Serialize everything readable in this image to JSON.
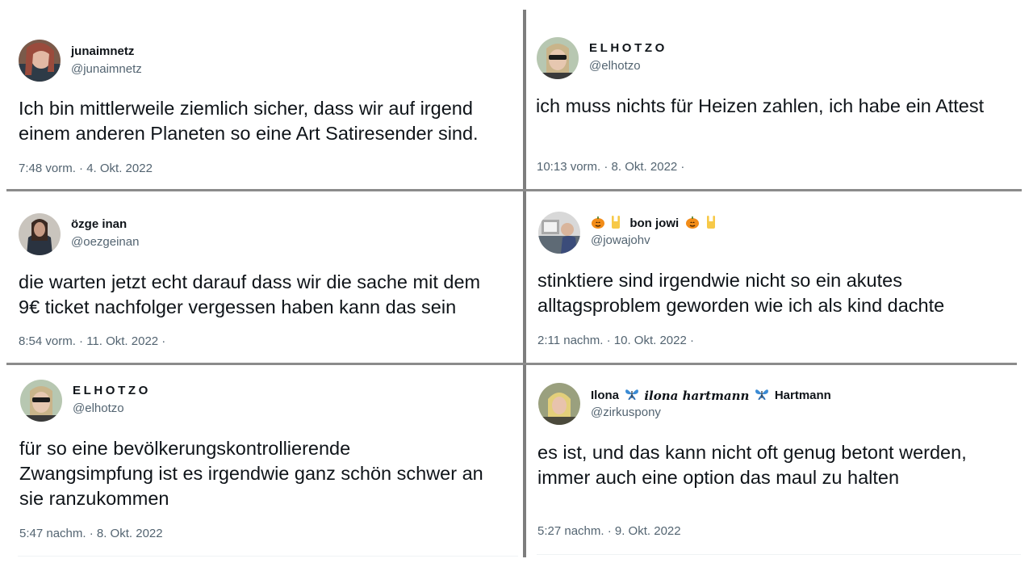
{
  "tweets": [
    {
      "name": "junaimnetz",
      "handle": "@junaimnetz",
      "text": "Ich bin mittlerweile ziemlich sicher, dass wir auf irgend\neinem anderen Planeten so eine Art Satiresender sind.",
      "meta": "7:48 vorm. · 4. Okt. 2022"
    },
    {
      "name": "ELHOTZO",
      "handle": "@elhotzo",
      "text": "ich muss nichts für Heizen zahlen, ich habe ein Attest",
      "meta": "10:13 vorm. · 8. Okt. 2022 ·"
    },
    {
      "name": "özge inan",
      "handle": "@oezgeinan",
      "text": "die warten jetzt echt darauf dass wir die sache mit dem\n9€ ticket nachfolger vergessen haben kann das sein",
      "meta": "8:54 vorm. · 11. Okt. 2022 ·"
    },
    {
      "name": "bon jowi",
      "handle": "@jowajohv",
      "text": "stinktiere sind irgendwie nicht so ein akutes\nalltagsproblem geworden wie ich als kind dachte",
      "meta": "2:11 nachm. · 10. Okt. 2022 ·"
    },
    {
      "name": "ELHOTZO",
      "handle": "@elhotzo",
      "text": "für so eine bevölkerungskontrollierende\nZwangsimpfung ist es irgendwie ganz schön schwer an\nsie ranzukommen",
      "meta": "5:47 nachm. · 8. Okt. 2022"
    },
    {
      "name_parts": [
        "Ilona",
        "ilona hartmann",
        "Hartmann"
      ],
      "handle": "@zirkuspony",
      "text": "es ist, und das kann nicht oft genug betont werden,\nimmer auch eine option das maul zu halten",
      "meta": "5:27 nachm. · 9. Okt. 2022"
    }
  ],
  "icons": {
    "pumpkin": "pumpkin-emoji",
    "rock_hand": "rock-hand-emoji",
    "butterfly": "butterfly-emoji"
  },
  "colors": {
    "text": "#0f1419",
    "secondary": "#536471",
    "divider": "#8b8b8b"
  }
}
